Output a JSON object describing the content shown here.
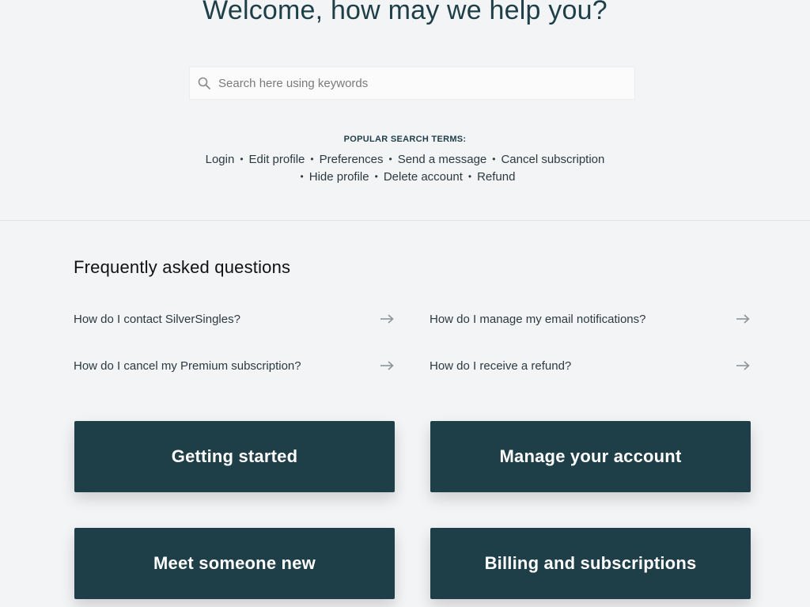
{
  "hero": {
    "title": "Welcome, how may we help you?"
  },
  "search": {
    "placeholder": "Search here using keywords",
    "icon": "search-icon"
  },
  "popular": {
    "heading": "POPULAR SEARCH TERMS:",
    "separator": "•",
    "terms": [
      "Login",
      "Edit profile",
      "Preferences",
      "Send a message",
      "Cancel subscription",
      "Hide profile",
      "Delete account",
      "Refund"
    ]
  },
  "faq": {
    "title": "Frequently asked questions",
    "arrow_icon": "arrow-right-icon",
    "items": [
      {
        "question": "How do I contact SilverSingles?"
      },
      {
        "question": "How do I manage my email notifications?"
      },
      {
        "question": "How do I cancel my Premium subscription?"
      },
      {
        "question": "How do I receive a refund?"
      }
    ]
  },
  "categories": [
    {
      "label": "Getting started"
    },
    {
      "label": "Manage your account"
    },
    {
      "label": "Meet someone new"
    },
    {
      "label": "Billing and subscriptions"
    }
  ],
  "colors": {
    "background": "#f3f4f6",
    "card": "#1f3f48",
    "title": "#1e3f48",
    "text": "#2c3a40"
  }
}
